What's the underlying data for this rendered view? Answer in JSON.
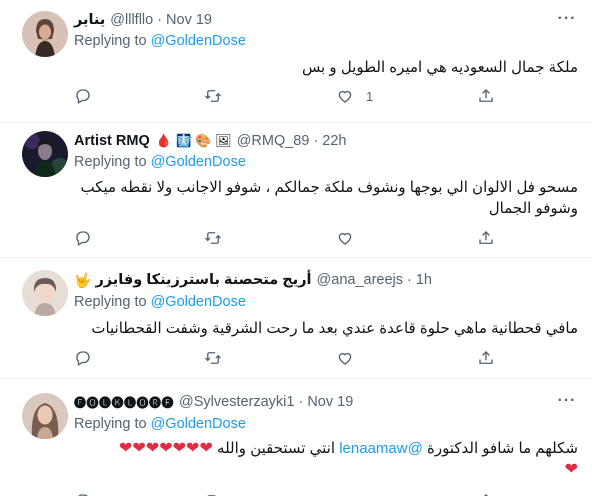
{
  "tweets": [
    {
      "name": "يناير",
      "handle": "@lllfllo",
      "time": "Nov 19",
      "replying_label": "Replying to",
      "replying_to": "@GoldenDose",
      "text": "ملكة جمال السعوديه هي اميره الطويل و بس",
      "like_count": "1",
      "avatar_colors": [
        "#c99a86",
        "#3a2a26"
      ]
    },
    {
      "name": "Artist RMQ",
      "name_emojis": [
        "🩸",
        "🩻",
        "🎨",
        "🖼"
      ],
      "handle": "@RMQ_89",
      "time": "22h",
      "replying_label": "Replying to",
      "replying_to": "@GoldenDose",
      "text_line1": "مسحو فل الالوان الي بوجها ونشوف ملكة جمالكم ، شوفو الاجانب ولا نقطه ميكب",
      "text_line2": "وشوفو الجمال",
      "like_count": "",
      "avatar_colors": [
        "#3b2a5a",
        "#1a1a2e"
      ]
    },
    {
      "name": "أريج متحصنة باسترزينكا وفايزر",
      "name_emoji": "🤟",
      "handle": "@ana_areejs",
      "time": "1h",
      "replying_label": "Replying to",
      "replying_to": "@GoldenDose",
      "text": "مافي قحطانية ماهي حلوة قاعدة عندي  بعد ما رحت الشرقية وشفت القحطانيات",
      "like_count": "",
      "avatar_colors": [
        "#e8ddd6",
        "#6b5a55"
      ]
    },
    {
      "name": "🅕🅞🅛🅚🅛🅞🅡🅔",
      "handle": "@Sylvesterzayki1",
      "time": "Nov 19",
      "replying_label": "Replying to",
      "replying_to": "@GoldenDose",
      "text_prefix": "شكلهم ما شافو الدكتورة",
      "text_mention": "@lenaamaw",
      "text_suffix": "انتي تستحقين والله",
      "hearts": "❤❤❤❤❤❤❤",
      "heart_last": "❤",
      "like_count": "",
      "avatar_colors": [
        "#d9c8be",
        "#7a5c4e"
      ]
    }
  ],
  "icons": {
    "reply": "reply-icon",
    "retweet": "retweet-icon",
    "like": "like-icon",
    "share": "share-icon",
    "more": "more-icon"
  },
  "colors": {
    "accent": "#1d9bf0",
    "secondary_text": "#536471",
    "divider": "#eff3f4",
    "heart": "#dd2e44"
  }
}
